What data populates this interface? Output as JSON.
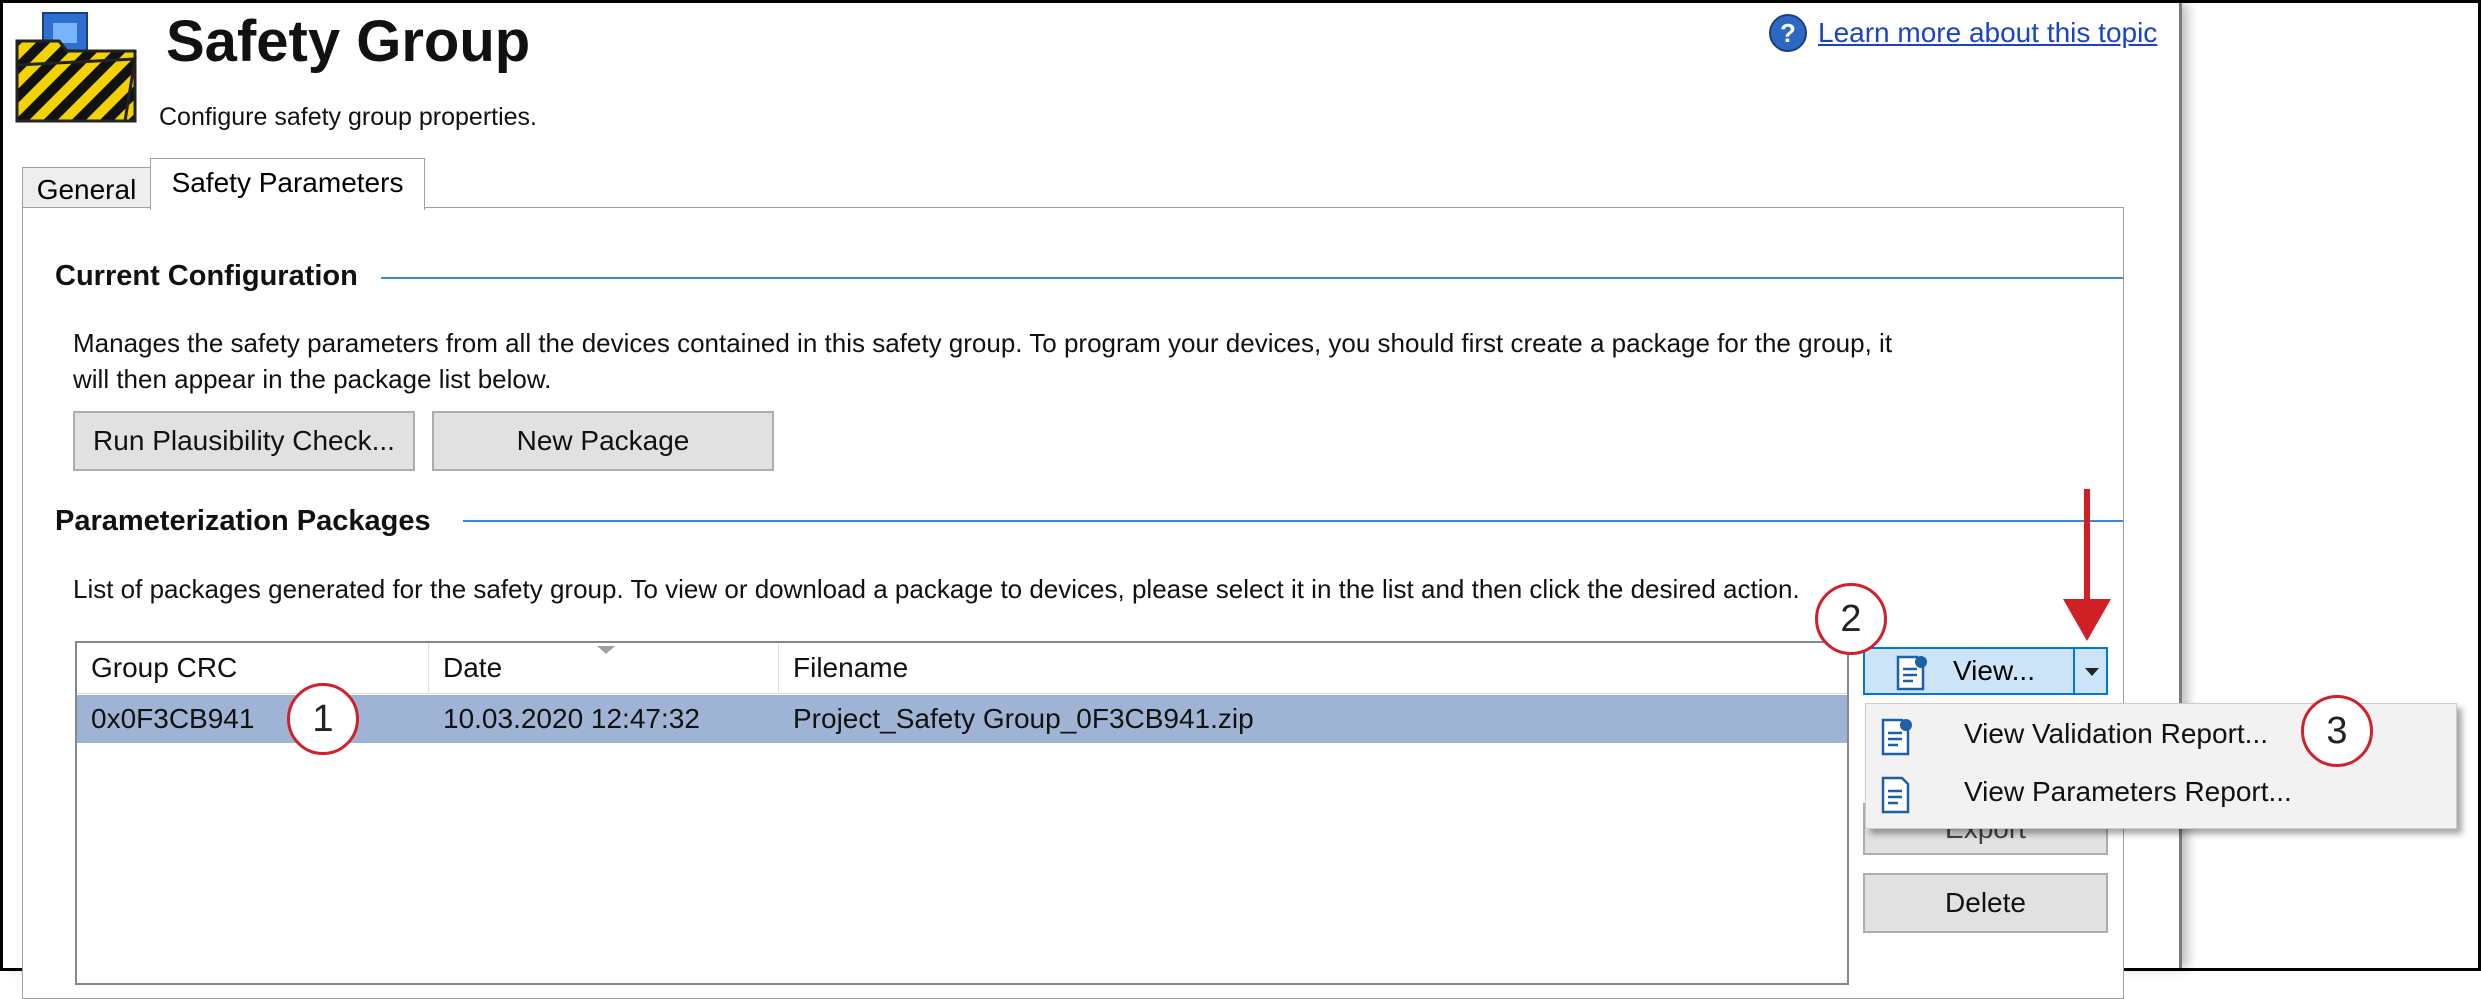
{
  "header": {
    "title": "Safety Group",
    "subtitle": "Configure safety group properties.",
    "help_link": "Learn more about this topic"
  },
  "tabs": [
    {
      "label": "General",
      "active": false
    },
    {
      "label": "Safety Parameters",
      "active": true
    }
  ],
  "current_config": {
    "title": "Current Configuration",
    "description_line1": "Manages the safety parameters from all the devices contained in this safety group.  To program your devices, you should first create a package for the group, it",
    "description_line2": "will then appear in the package list below.",
    "run_button": "Run Plausibility Check...",
    "new_package_button": "New Package"
  },
  "packages": {
    "title": "Parameterization Packages",
    "description": "List of packages generated for the safety group.  To view or download a package to devices, please select it in the list and then click the desired action.",
    "columns": [
      "Group CRC",
      "Date",
      "Filename"
    ],
    "rows": [
      {
        "crc": "0x0F3CB941",
        "date": "10.03.2020 12:47:32",
        "filename": "Project_Safety Group_0F3CB941.zip",
        "selected": true
      }
    ]
  },
  "actions": {
    "view_button": "View...",
    "export_button": "Export",
    "delete_button": "Delete"
  },
  "view_menu": {
    "items": [
      {
        "label": "View Validation Report...",
        "icon": "validation-report-icon"
      },
      {
        "label": "View Parameters Report...",
        "icon": "parameters-report-icon"
      }
    ]
  },
  "annotations": {
    "step1": "1",
    "step2": "2",
    "step3": "3",
    "color": "#d0202a"
  }
}
